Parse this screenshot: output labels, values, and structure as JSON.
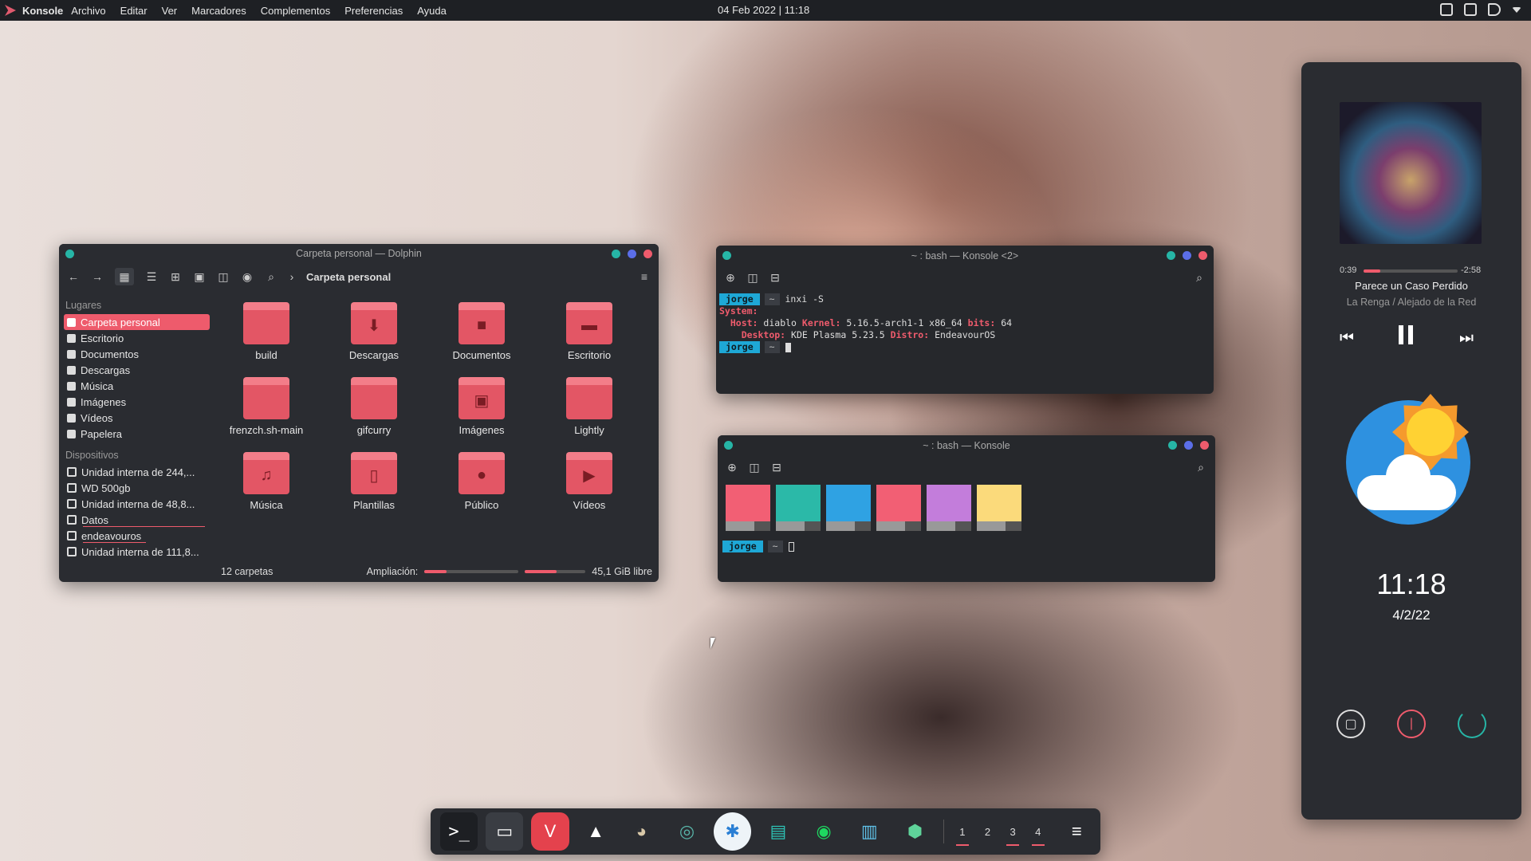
{
  "topbar": {
    "app": "Konsole",
    "menu": [
      "Archivo",
      "Editar",
      "Ver",
      "Marcadores",
      "Complementos",
      "Preferencias",
      "Ayuda"
    ],
    "datetime": "04 Feb 2022 | 11:18"
  },
  "dolphin": {
    "title": "Carpeta personal — Dolphin",
    "breadcrumb": "Carpeta personal",
    "places_header": "Lugares",
    "places": [
      "Carpeta personal",
      "Escritorio",
      "Documentos",
      "Descargas",
      "Música",
      "Imágenes",
      "Vídeos",
      "Papelera"
    ],
    "devices_header": "Dispositivos",
    "devices": [
      "Unidad interna de 244,...",
      "WD 500gb",
      "Unidad interna de 48,8...",
      "Datos",
      "endeavouros",
      "Unidad interna de 111,8..."
    ],
    "folders": [
      "build",
      "Descargas",
      "Documentos",
      "Escritorio",
      "frenzch.sh-main",
      "gifcurry",
      "Imágenes",
      "Lightly",
      "Música",
      "Plantillas",
      "Público",
      "Vídeos"
    ],
    "status_count": "12 carpetas",
    "zoom_label": "Ampliación:",
    "free_space": "45,1 GiB libre"
  },
  "konsole2": {
    "title": "~ : bash — Konsole <2>",
    "user": "jorge",
    "path": "~",
    "command": "inxi -S",
    "system_label": "System:",
    "host_label": "Host:",
    "host": "diablo",
    "kernel_label": "Kernel:",
    "kernel": "5.16.5-arch1-1 x86_64",
    "bits_label": "bits:",
    "bits": "64",
    "desktop_label": "Desktop:",
    "desktop": "KDE Plasma 5.23.5",
    "distro_label": "Distro:",
    "distro": "EndeavourOS"
  },
  "konsole1": {
    "title": "~ : bash — Konsole",
    "user": "jorge",
    "path": "~",
    "colors": [
      "#f25f74",
      "#2bb9a8",
      "#2fa2e3",
      "#f25f74",
      "#c37ddb",
      "#fbda7b"
    ]
  },
  "player": {
    "elapsed": "0:39",
    "remaining": "-2:58",
    "progress": 0.18,
    "track": "Parece un Caso Perdido",
    "artist": "La Renga / Alejado de la Red"
  },
  "clock": {
    "time": "11:18",
    "date": "4/2/22"
  },
  "dock": {
    "apps": [
      "terminal",
      "files",
      "vivaldi",
      "inkscape",
      "gimp",
      "tor",
      "browser",
      "disks",
      "spotify",
      "reader",
      "vpn"
    ],
    "workspaces": [
      "1",
      "2",
      "3",
      "4"
    ]
  }
}
